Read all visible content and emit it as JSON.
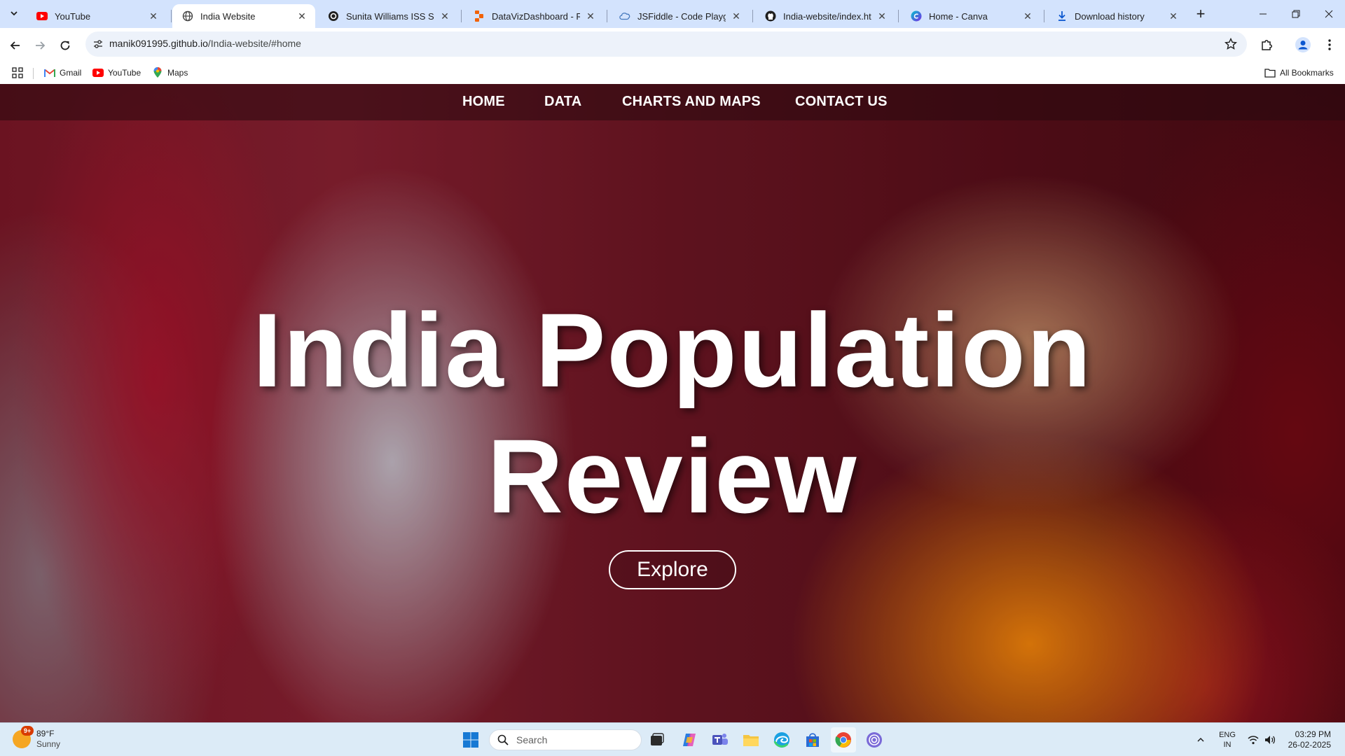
{
  "browser": {
    "tabs": [
      {
        "title": "YouTube",
        "icon": "youtube-icon",
        "active": false
      },
      {
        "title": "India Website",
        "icon": "globe-icon",
        "active": true
      },
      {
        "title": "Sunita Williams ISS Stay",
        "icon": "openai-icon",
        "active": false
      },
      {
        "title": "DataVizDashboard - Repli",
        "icon": "replit-icon",
        "active": false
      },
      {
        "title": "JSFiddle - Code Playgrou",
        "icon": "jsfiddle-icon",
        "active": false
      },
      {
        "title": "India-website/index.html",
        "icon": "github-icon",
        "active": false
      },
      {
        "title": "Home - Canva",
        "icon": "canva-icon",
        "active": false
      },
      {
        "title": "Download history",
        "icon": "download-icon",
        "active": false
      }
    ],
    "address": {
      "host": "manik091995.github.io",
      "path": "/India-website/#home"
    },
    "bookmarks": [
      {
        "label": "Gmail",
        "icon": "gmail-icon"
      },
      {
        "label": "YouTube",
        "icon": "youtube-icon"
      },
      {
        "label": "Maps",
        "icon": "maps-icon"
      }
    ],
    "all_bookmarks_label": "All Bookmarks"
  },
  "site": {
    "nav": [
      "HOME",
      "DATA",
      "CHARTS AND MAPS",
      "CONTACT US"
    ],
    "hero": {
      "title_line1": "India Population",
      "title_line2": "Review",
      "button_label": "Explore"
    }
  },
  "taskbar": {
    "weather": {
      "temp": "89°F",
      "condition": "Sunny",
      "badge": "9+"
    },
    "search_placeholder": "Search",
    "language": {
      "line1": "ENG",
      "line2": "IN"
    },
    "time": "03:29 PM",
    "date": "26-02-2025"
  },
  "colors": {
    "tabstrip": "#d3e3fd",
    "accent": "#0b57d0",
    "youtube_red": "#ff0000",
    "hero_text": "#ffffff"
  }
}
